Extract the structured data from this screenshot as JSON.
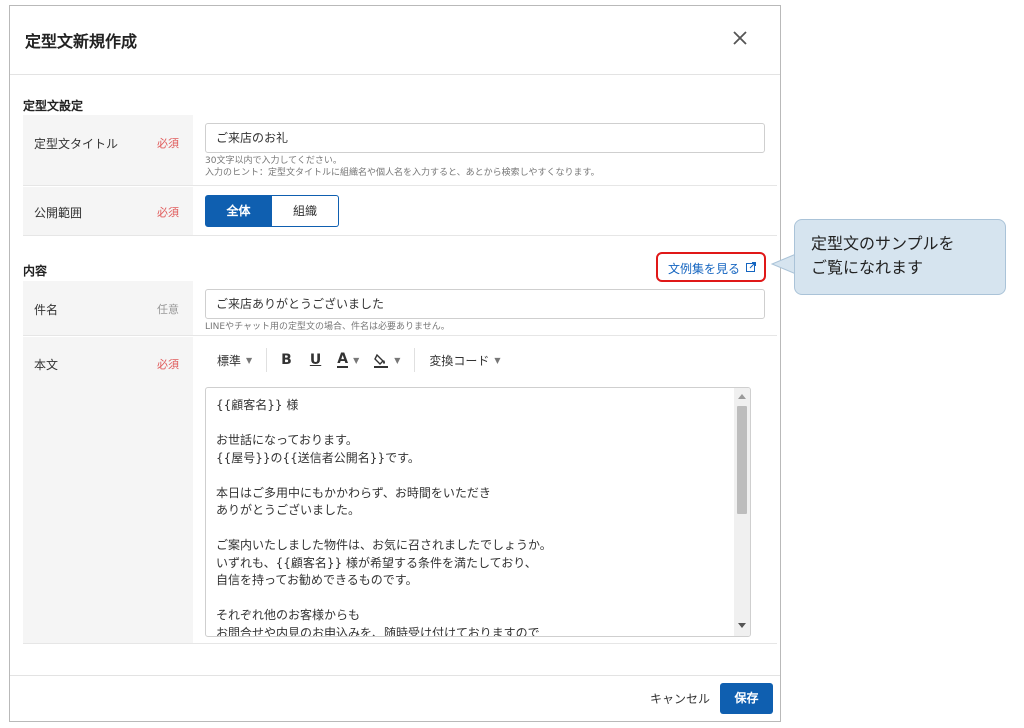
{
  "modal": {
    "title": "定型文新規作成"
  },
  "settings": {
    "section_label": "定型文設定",
    "title_row": {
      "label": "定型文タイトル",
      "required": "必須",
      "value": "ご来店のお礼",
      "hint_line1": "30文字以内で入力してください。",
      "hint_line2": "入力のヒント：定型文タイトルに組織名や個人名を入力すると、あとから検索しやすくなります。"
    },
    "scope_row": {
      "label": "公開範囲",
      "required": "必須",
      "options": [
        "全体",
        "組織"
      ],
      "selected": "全体"
    }
  },
  "content": {
    "section_label": "内容",
    "sample_link": "文例集を見る",
    "subject_row": {
      "label": "件名",
      "optional": "任意",
      "value": "ご来店ありがとうございました",
      "hint": "LINEやチャット用の定型文の場合、件名は必要ありません。"
    },
    "body_row": {
      "label": "本文",
      "required": "必須",
      "toolbar": {
        "style": "標準",
        "bold": "B",
        "underline": "U",
        "font_color": "A",
        "convert_code": "変換コード"
      },
      "text": "{{顧客名}} 様\n\nお世話になっております。\n{{屋号}}の{{送信者公開名}}です。\n\n本日はご多用中にもかかわらず、お時間をいただき\nありがとうございました。\n\nご案内いたしました物件は、お気に召されましたでしょうか。\nいずれも、{{顧客名}} 様が希望する条件を満たしており、\n自信を持ってお勧めできるものです。\n\nそれぞれ他のお客様からも\nお問合せや内見のお申込みを、随時受け付けておりますので"
    }
  },
  "footer": {
    "cancel": "キャンセル",
    "save": "保存"
  },
  "callout": {
    "text": "定型文のサンプルを\nご覧になれます"
  },
  "colors": {
    "primary": "#0f5fb0",
    "required": "#e05a5a",
    "link": "#1565c0",
    "highlight": "#e01818",
    "callout_bg": "#d6e4ef"
  }
}
